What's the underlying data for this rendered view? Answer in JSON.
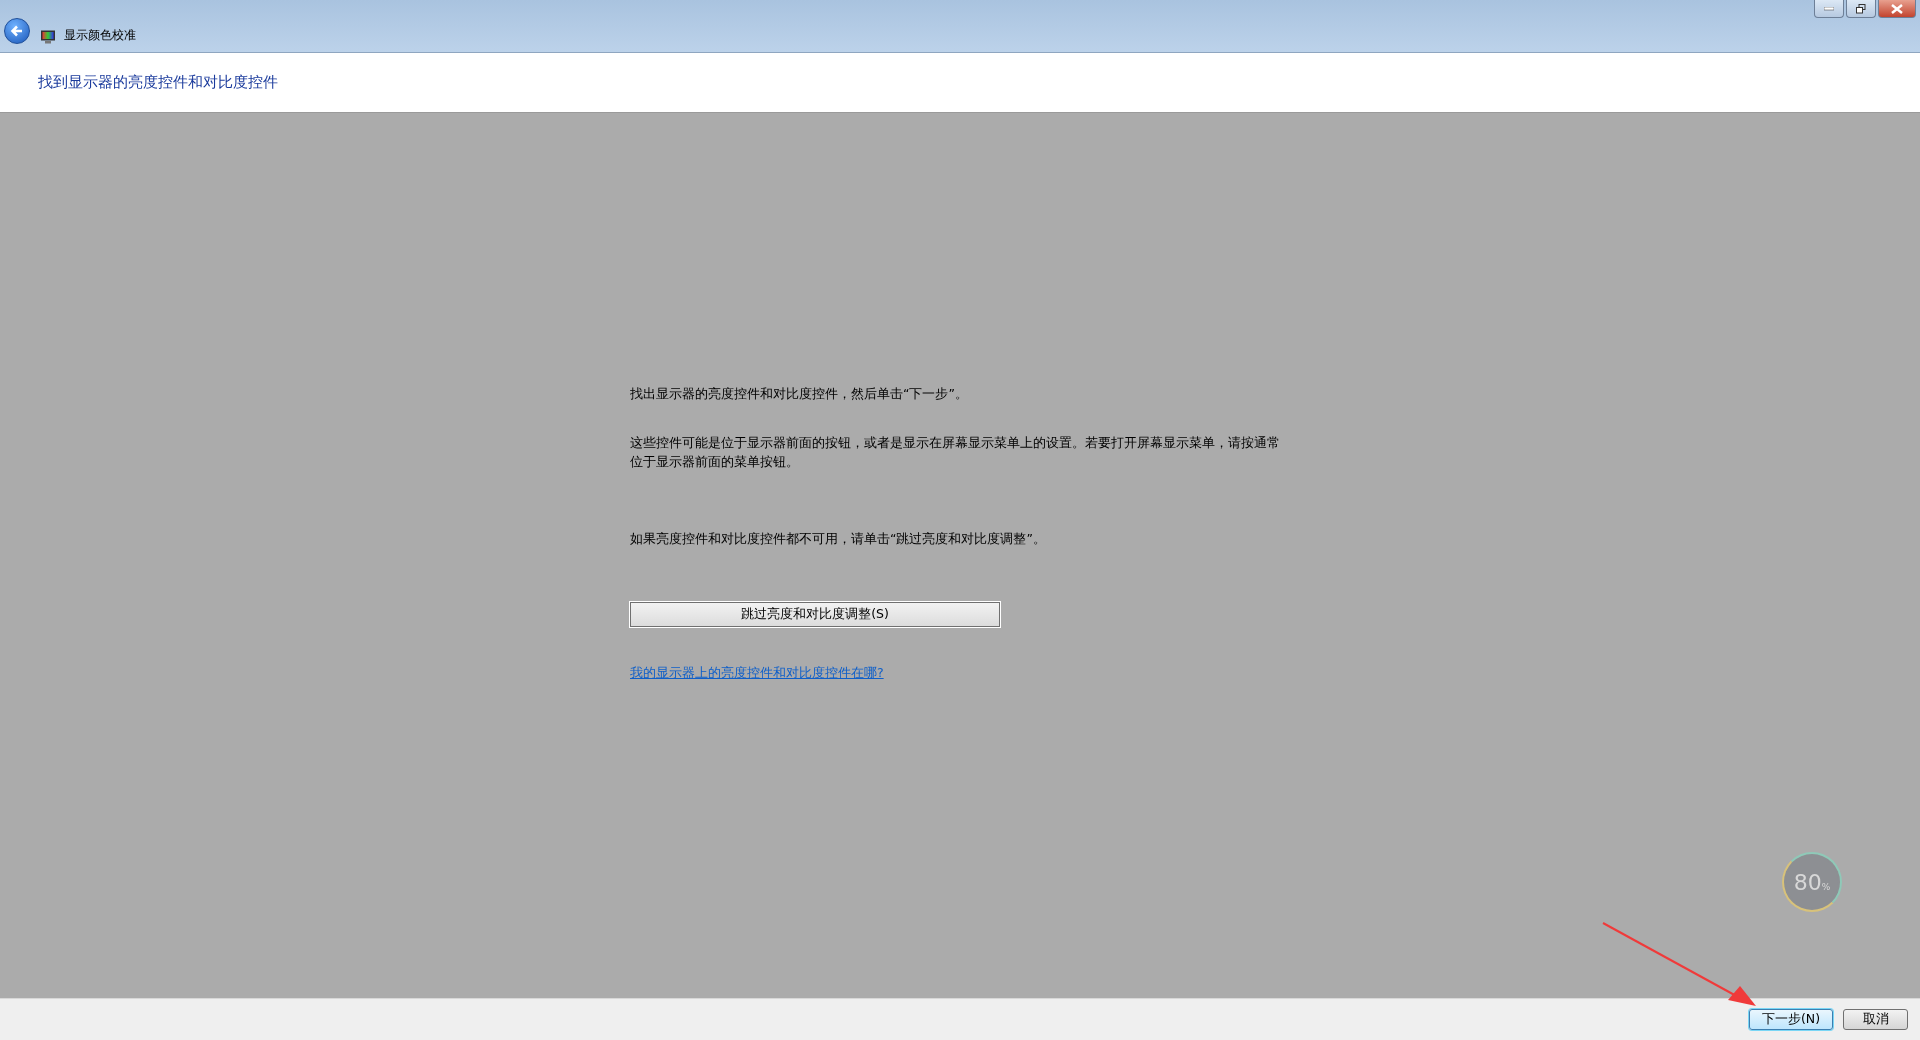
{
  "window": {
    "title": "显示颜色校准"
  },
  "heading": "找到显示器的亮度控件和对比度控件",
  "paragraphs": [
    "找出显示器的亮度控件和对比度控件，然后单击“下一步”。",
    "这些控件可能是位于显示器前面的按钮，或者是显示在屏幕显示菜单上的设置。若要打开屏幕显示菜单，请按通常位于显示器前面的菜单按钮。",
    "如果亮度控件和对比度控件都不可用，请单击“跳过亮度和对比度调整”。"
  ],
  "skip_button": "跳过亮度和对比度调整(S)",
  "help_link": "我的显示器上的亮度控件和对比度控件在哪?",
  "gauge": {
    "value": "80",
    "unit": "%"
  },
  "buttons": [
    {
      "label": "下一步(N)",
      "selected": true
    },
    {
      "label": "取消",
      "selected": false
    }
  ]
}
